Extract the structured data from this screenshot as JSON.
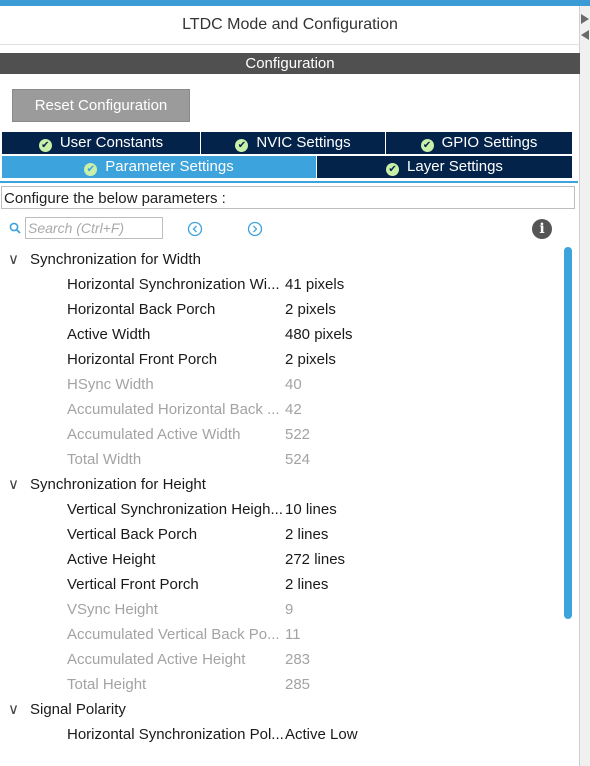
{
  "window": {
    "title": "LTDC Mode and Configuration"
  },
  "config_header": "Configuration",
  "reset_button": "Reset Configuration",
  "tabs_row1": [
    {
      "label": "User Constants"
    },
    {
      "label": "NVIC Settings"
    },
    {
      "label": "GPIO Settings"
    }
  ],
  "tabs_row2": [
    {
      "label": "Parameter Settings",
      "active": true
    },
    {
      "label": "Layer Settings"
    }
  ],
  "configure_label": "Configure the below parameters :",
  "search": {
    "placeholder": "Search (Ctrl+F)"
  },
  "groups": [
    {
      "label": "Synchronization for Width",
      "params": [
        {
          "name": "Horizontal Synchronization Wi...",
          "value": "41 pixels",
          "readonly": false
        },
        {
          "name": "Horizontal Back Porch",
          "value": "2 pixels",
          "readonly": false
        },
        {
          "name": "Active Width",
          "value": "480 pixels",
          "readonly": false
        },
        {
          "name": "Horizontal Front Porch",
          "value": "2 pixels",
          "readonly": false
        },
        {
          "name": "HSync Width",
          "value": "40",
          "readonly": true
        },
        {
          "name": "Accumulated Horizontal Back ...",
          "value": "42",
          "readonly": true
        },
        {
          "name": "Accumulated Active Width",
          "value": "522",
          "readonly": true
        },
        {
          "name": "Total Width",
          "value": "524",
          "readonly": true
        }
      ]
    },
    {
      "label": "Synchronization for Height",
      "params": [
        {
          "name": "Vertical Synchronization Heigh...",
          "value": "10 lines",
          "readonly": false
        },
        {
          "name": "Vertical Back Porch",
          "value": "2 lines",
          "readonly": false
        },
        {
          "name": "Active Height",
          "value": "272 lines",
          "readonly": false
        },
        {
          "name": "Vertical Front Porch",
          "value": "2 lines",
          "readonly": false
        },
        {
          "name": "VSync Height",
          "value": "9",
          "readonly": true
        },
        {
          "name": "Accumulated Vertical Back Po...",
          "value": "11",
          "readonly": true
        },
        {
          "name": "Accumulated Active Height",
          "value": "283",
          "readonly": true
        },
        {
          "name": "Total Height",
          "value": "285",
          "readonly": true
        }
      ]
    },
    {
      "label": "Signal Polarity",
      "params": [
        {
          "name": "Horizontal Synchronization Pol...",
          "value": "Active Low",
          "readonly": false
        }
      ]
    }
  ],
  "colors": {
    "tab_dark": "#03234b",
    "tab_active": "#3ca3dc",
    "header_bar": "#505050",
    "readonly_text": "#a3a3a3"
  }
}
